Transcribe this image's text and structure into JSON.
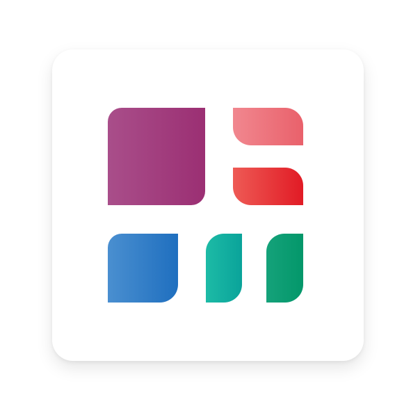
{
  "logo": {
    "name": "app-icon-grid-tiles",
    "colors": {
      "purple": [
        "#a94e8a",
        "#9b2f73"
      ],
      "pink": [
        "#f1878f",
        "#e9616b"
      ],
      "red": [
        "#ee5a55",
        "#e11b25"
      ],
      "blue": [
        "#4a8fd0",
        "#1f6fbf"
      ],
      "teal": [
        "#1dbba6",
        "#0aa39a"
      ],
      "green": [
        "#15a27a",
        "#03976a"
      ]
    }
  }
}
